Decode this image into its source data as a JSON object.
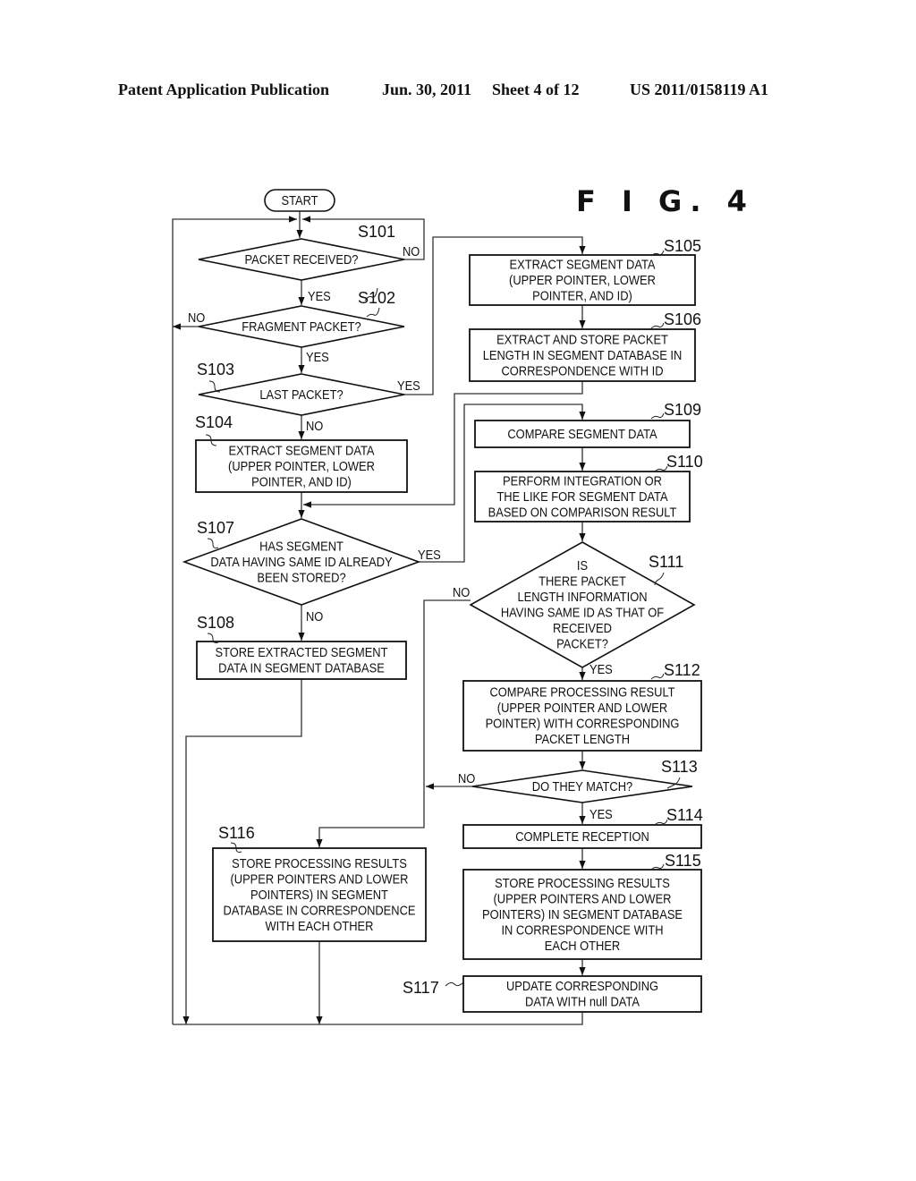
{
  "header": {
    "publication": "Patent Application Publication",
    "date": "Jun. 30, 2011",
    "sheet": "Sheet 4 of 12",
    "number": "US 2011/0158119 A1"
  },
  "figure": {
    "title": "F I G.  4"
  },
  "nodes": {
    "start": {
      "type": "terminal",
      "lines": [
        "START"
      ]
    },
    "s101": {
      "step": "S101",
      "type": "decision",
      "lines": [
        "PACKET RECEIVED?"
      ]
    },
    "s102": {
      "step": "S102",
      "type": "decision",
      "lines": [
        "FRAGMENT PACKET?"
      ]
    },
    "s103": {
      "step": "S103",
      "type": "decision",
      "lines": [
        "LAST PACKET?"
      ]
    },
    "s104": {
      "step": "S104",
      "type": "process",
      "lines": [
        "EXTRACT SEGMENT DATA",
        "(UPPER POINTER, LOWER",
        "POINTER, AND ID)"
      ]
    },
    "s105": {
      "step": "S105",
      "type": "process",
      "lines": [
        "EXTRACT SEGMENT DATA",
        "(UPPER POINTER, LOWER",
        "POINTER, AND ID)"
      ]
    },
    "s106": {
      "step": "S106",
      "type": "process",
      "lines": [
        "EXTRACT AND STORE PACKET",
        "LENGTH IN SEGMENT DATABASE IN",
        "CORRESPONDENCE WITH ID"
      ]
    },
    "s107": {
      "step": "S107",
      "type": "decision",
      "lines": [
        "HAS SEGMENT",
        "DATA HAVING SAME ID ALREADY",
        "BEEN STORED?"
      ]
    },
    "s108": {
      "step": "S108",
      "type": "process",
      "lines": [
        "STORE EXTRACTED SEGMENT",
        "DATA IN SEGMENT DATABASE"
      ]
    },
    "s109": {
      "step": "S109",
      "type": "process",
      "lines": [
        "COMPARE SEGMENT DATA"
      ]
    },
    "s110": {
      "step": "S110",
      "type": "process",
      "lines": [
        "PERFORM INTEGRATION OR",
        "THE LIKE FOR SEGMENT DATA",
        "BASED ON COMPARISON RESULT"
      ]
    },
    "s111": {
      "step": "S111",
      "type": "decision",
      "lines": [
        "IS",
        "THERE PACKET",
        "LENGTH INFORMATION",
        "HAVING SAME ID AS THAT OF",
        "RECEIVED",
        "PACKET?"
      ]
    },
    "s112": {
      "step": "S112",
      "type": "process",
      "lines": [
        "COMPARE PROCESSING RESULT",
        "(UPPER POINTER AND LOWER",
        "POINTER) WITH CORRESPONDING",
        "PACKET LENGTH"
      ]
    },
    "s113": {
      "step": "S113",
      "type": "decision",
      "lines": [
        "DO THEY MATCH?"
      ]
    },
    "s114": {
      "step": "S114",
      "type": "process",
      "lines": [
        "COMPLETE RECEPTION"
      ]
    },
    "s115": {
      "step": "S115",
      "type": "process",
      "lines": [
        "STORE PROCESSING RESULTS",
        "(UPPER POINTERS AND LOWER",
        "POINTERS) IN SEGMENT DATABASE",
        "IN CORRESPONDENCE WITH",
        "EACH OTHER"
      ]
    },
    "s116": {
      "step": "S116",
      "type": "process",
      "lines": [
        "STORE PROCESSING RESULTS",
        "(UPPER POINTERS AND LOWER",
        "POINTERS) IN SEGMENT",
        "DATABASE IN CORRESPONDENCE",
        "WITH EACH OTHER"
      ]
    },
    "s117": {
      "step": "S117",
      "type": "process",
      "lines": [
        "UPDATE CORRESPONDING",
        "DATA WITH null DATA"
      ]
    }
  },
  "edges": {
    "s101_no": "NO",
    "s101_yes": "YES",
    "s102_no": "NO",
    "s102_yes": "YES",
    "s103_yes": "YES",
    "s103_no": "NO",
    "s107_yes": "YES",
    "s107_no": "NO",
    "s111_no": "NO",
    "s111_yes": "YES",
    "s113_no": "NO",
    "s113_yes": "YES"
  }
}
